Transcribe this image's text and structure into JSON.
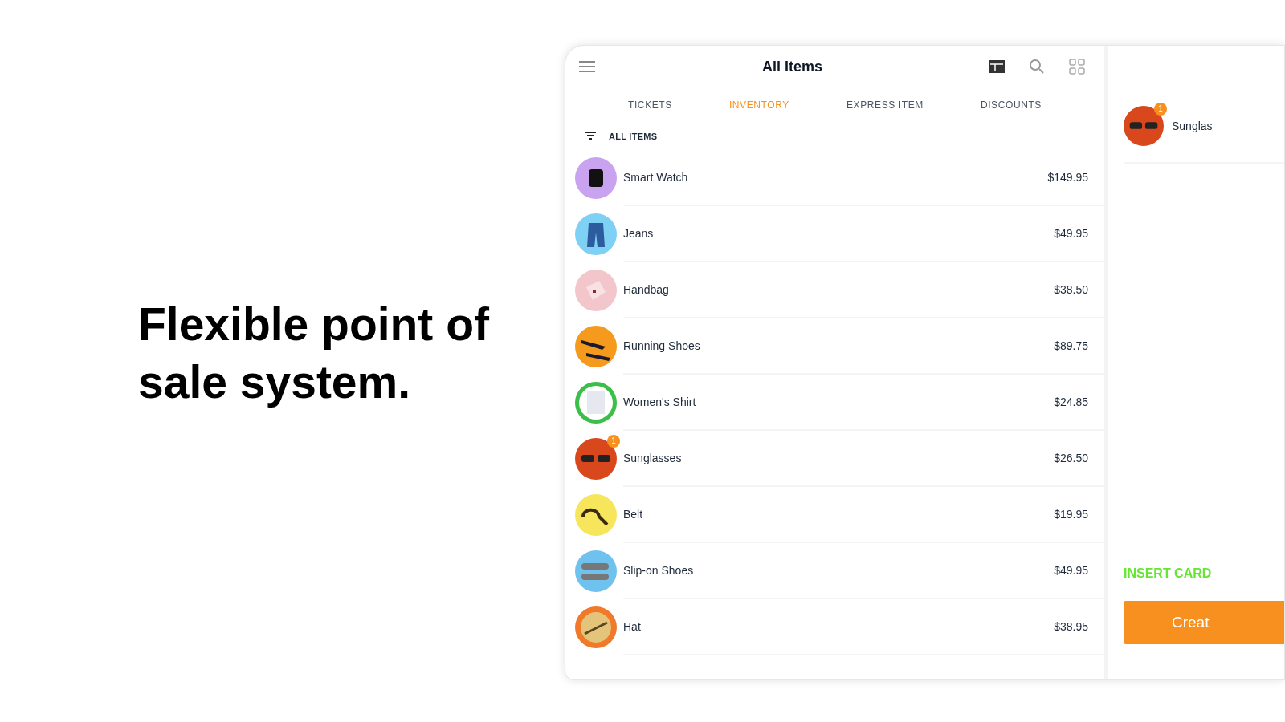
{
  "headline": "Flexible point of sale system.",
  "app": {
    "title": "All Items",
    "tabs": [
      {
        "label": "TICKETS",
        "selected": false
      },
      {
        "label": "INVENTORY",
        "selected": true
      },
      {
        "label": "EXPRESS ITEM",
        "selected": false
      },
      {
        "label": "DISCOUNTS",
        "selected": false
      }
    ],
    "filter_label": "ALL ITEMS",
    "items": [
      {
        "name": "Smart Watch",
        "price": "$149.95"
      },
      {
        "name": "Jeans",
        "price": "$49.95"
      },
      {
        "name": "Handbag",
        "price": "$38.50"
      },
      {
        "name": "Running Shoes",
        "price": "$89.75"
      },
      {
        "name": "Women's Shirt",
        "price": "$24.85"
      },
      {
        "name": "Sunglasses",
        "price": "$26.50",
        "badge": "1"
      },
      {
        "name": "Belt",
        "price": "$19.95"
      },
      {
        "name": "Slip-on Shoes",
        "price": "$49.95"
      },
      {
        "name": "Hat",
        "price": "$38.95"
      }
    ],
    "ticket": {
      "items": [
        {
          "name": "Sunglas",
          "badge": "1"
        }
      ],
      "card_prompt": "INSERT CARD",
      "action_button": "Creat"
    }
  }
}
